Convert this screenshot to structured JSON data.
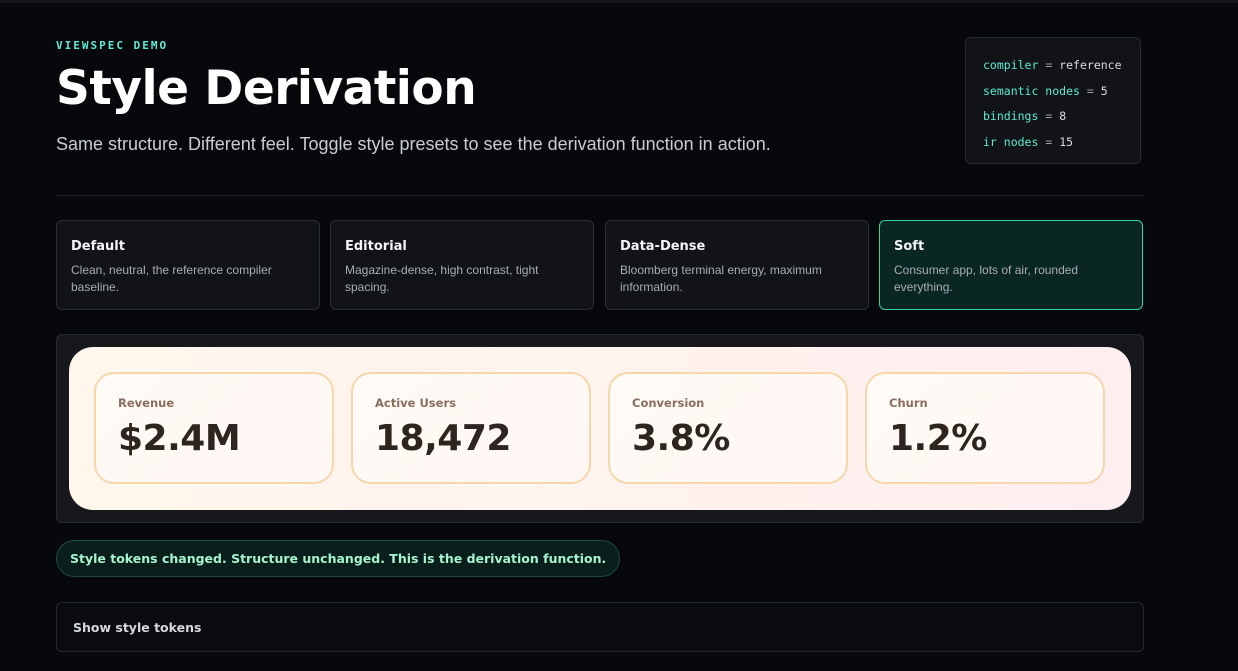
{
  "header": {
    "eyebrow": "VIEWSPEC DEMO",
    "title": "Style Derivation",
    "subtitle": "Same structure. Different feel. Toggle style presets to see the derivation function in action."
  },
  "compiler_info": [
    {
      "key": "compiler",
      "value": "reference"
    },
    {
      "key": "semantic nodes",
      "value": "5"
    },
    {
      "key": "bindings",
      "value": "8"
    },
    {
      "key": "ir nodes",
      "value": "15"
    }
  ],
  "presets": [
    {
      "name": "Default",
      "description": "Clean, neutral, the reference compiler baseline.",
      "active": false
    },
    {
      "name": "Editorial",
      "description": "Magazine-dense, high contrast, tight spacing.",
      "active": false
    },
    {
      "name": "Data-Dense",
      "description": "Bloomberg terminal energy, maximum information.",
      "active": false
    },
    {
      "name": "Soft",
      "description": "Consumer app, lots of air, rounded everything.",
      "active": true
    }
  ],
  "metrics": [
    {
      "label": "Revenue",
      "value": "$2.4M"
    },
    {
      "label": "Active Users",
      "value": "18,472"
    },
    {
      "label": "Conversion",
      "value": "3.8%"
    },
    {
      "label": "Churn",
      "value": "1.2%"
    }
  ],
  "status_message": "Style tokens changed. Structure unchanged. This is the derivation function.",
  "tokens_toggle_label": "Show style tokens",
  "colors": {
    "accent": "#5eead4",
    "active_preset_border": "#34d399",
    "background": "#07080b"
  }
}
